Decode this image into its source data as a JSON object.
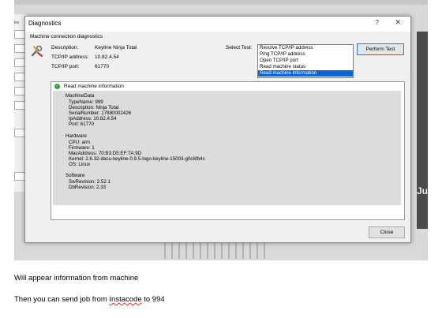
{
  "background": {
    "left_tab_text": "ies",
    "right_text": "Ju"
  },
  "dialog": {
    "title": "Diagnostics",
    "help": "?",
    "close_x": "✕",
    "section": "Machine connection diagnostics",
    "info": {
      "description_label": "Description:",
      "description_value": "Keyline Ninja Total",
      "address_label": "TCP/IP address:",
      "address_value": "10.82.4.54",
      "port_label": "TCP/IP port:",
      "port_value": "61770"
    },
    "select_test_label": "Select Test:",
    "tests": [
      "Resolve TCP/IP address",
      "Ping TCP/IP address",
      "Open TCP/IP port",
      "Read machine status",
      "Read machine information"
    ],
    "selected_test_index": 4,
    "perform_button": "Perform Test",
    "close_button": "Close"
  },
  "results": {
    "title": "Read machine information",
    "machine_data": {
      "header": "MachineData",
      "lines": [
        "TypeName: 999",
        "Description: Ninja Total",
        "SerialNumber: 17880002426",
        "IpAddress: 10.82.4.54",
        "Port: 61770"
      ]
    },
    "hardware": {
      "header": "Hardware",
      "lines": [
        "CPU: arm",
        "Firmware: 1",
        "MacAddress: 70:B3:D5:EF:7A:9D",
        "Kernel: 2.6.32-dacu-keyline-0.9.5-logo-keyline-15003-g0c6fb4c",
        "OS: Linux"
      ]
    },
    "software": {
      "header": "Software",
      "lines": [
        "SwRevision: 2.52.1",
        "DbRevision: 2.33"
      ]
    }
  },
  "captions": {
    "line1": "Will appear information from machine",
    "line2_prefix": "Then you can send job from ",
    "line2_word": "Instacode",
    "line2_suffix": " to 994"
  },
  "colors": {
    "selection": "#0a64d6",
    "success": "#2fa12f",
    "spell_error": "#e03030"
  }
}
